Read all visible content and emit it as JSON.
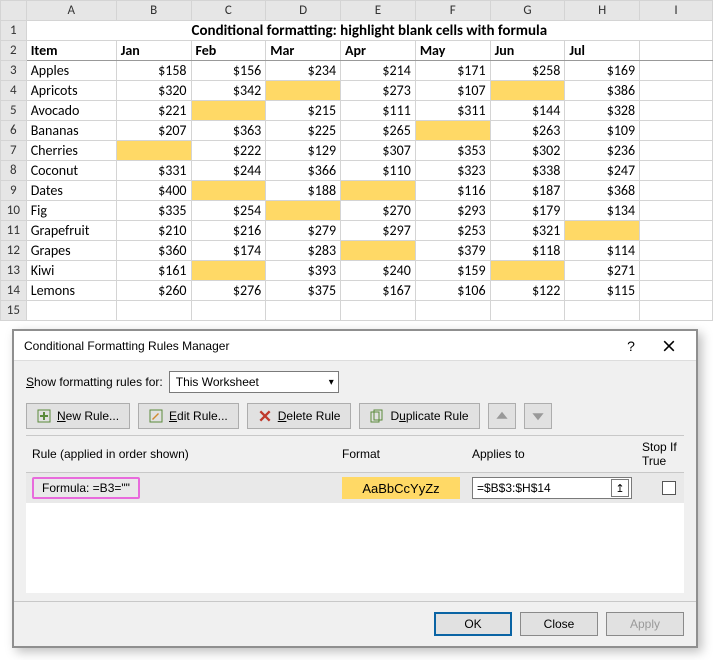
{
  "sheet": {
    "columns": [
      "",
      "A",
      "B",
      "C",
      "D",
      "E",
      "F",
      "G",
      "H",
      "I"
    ],
    "title": "Conditional formatting: highlight blank cells with formula",
    "header": [
      "Item",
      "Jan",
      "Feb",
      "Mar",
      "Apr",
      "May",
      "Jun",
      "Jul"
    ],
    "rows_start": 3,
    "rows": [
      {
        "item": "Apples",
        "vals": [
          "$158",
          "$156",
          "$234",
          "$214",
          "$171",
          "$258",
          "$169"
        ],
        "hl": []
      },
      {
        "item": "Apricots",
        "vals": [
          "$320",
          "$342",
          "",
          "$273",
          "$107",
          "",
          "$386"
        ],
        "hl": [
          2,
          5
        ]
      },
      {
        "item": "Avocado",
        "vals": [
          "$221",
          "",
          "$215",
          "$111",
          "$311",
          "$144",
          "$328"
        ],
        "hl": [
          1
        ]
      },
      {
        "item": "Bananas",
        "vals": [
          "$207",
          "$363",
          "$225",
          "$265",
          "",
          "$263",
          "$109"
        ],
        "hl": [
          4
        ]
      },
      {
        "item": "Cherries",
        "vals": [
          "",
          "$222",
          "$129",
          "$307",
          "$353",
          "$302",
          "$236"
        ],
        "hl": [
          0
        ]
      },
      {
        "item": "Coconut",
        "vals": [
          "$331",
          "$244",
          "$366",
          "$110",
          "$323",
          "$338",
          "$247"
        ],
        "hl": []
      },
      {
        "item": "Dates",
        "vals": [
          "$400",
          "",
          "$188",
          "",
          "$116",
          "$187",
          "$368"
        ],
        "hl": [
          1,
          3
        ]
      },
      {
        "item": "Fig",
        "vals": [
          "$335",
          "$254",
          "",
          "$270",
          "$293",
          "$179",
          "$134"
        ],
        "hl": [
          2
        ]
      },
      {
        "item": "Grapefruit",
        "vals": [
          "$210",
          "$216",
          "$279",
          "$297",
          "$253",
          "$321",
          ""
        ],
        "hl": [
          6
        ]
      },
      {
        "item": "Grapes",
        "vals": [
          "$360",
          "$174",
          "$283",
          "",
          "$379",
          "$118",
          "$114"
        ],
        "hl": [
          3
        ]
      },
      {
        "item": "Kiwi",
        "vals": [
          "$161",
          "",
          "$393",
          "$240",
          "$159",
          "",
          "$271"
        ],
        "hl": [
          1,
          5
        ]
      },
      {
        "item": "Lemons",
        "vals": [
          "$260",
          "$276",
          "$375",
          "$167",
          "$106",
          "$122",
          "$115"
        ],
        "hl": []
      }
    ]
  },
  "dialog": {
    "title": "Conditional Formatting Rules Manager",
    "show_label_pre": "S",
    "show_label_post": "how formatting rules for:",
    "scope_value": "This Worksheet",
    "buttons": {
      "new": "New Rule...",
      "edit": "Edit Rule...",
      "delete": "Delete Rule",
      "duplicate": "Duplicate Rule"
    },
    "headers": {
      "rule": "Rule (applied in order shown)",
      "format": "Format",
      "applies": "Applies to",
      "stop": "Stop If True"
    },
    "rule": {
      "formula": "Formula: =B3=\"\"",
      "sample_text": "AaBbCcYyZz",
      "applies_to": "=$B$3:$H$14"
    },
    "footer": {
      "ok": "OK",
      "close": "Close",
      "apply": "Apply"
    }
  }
}
